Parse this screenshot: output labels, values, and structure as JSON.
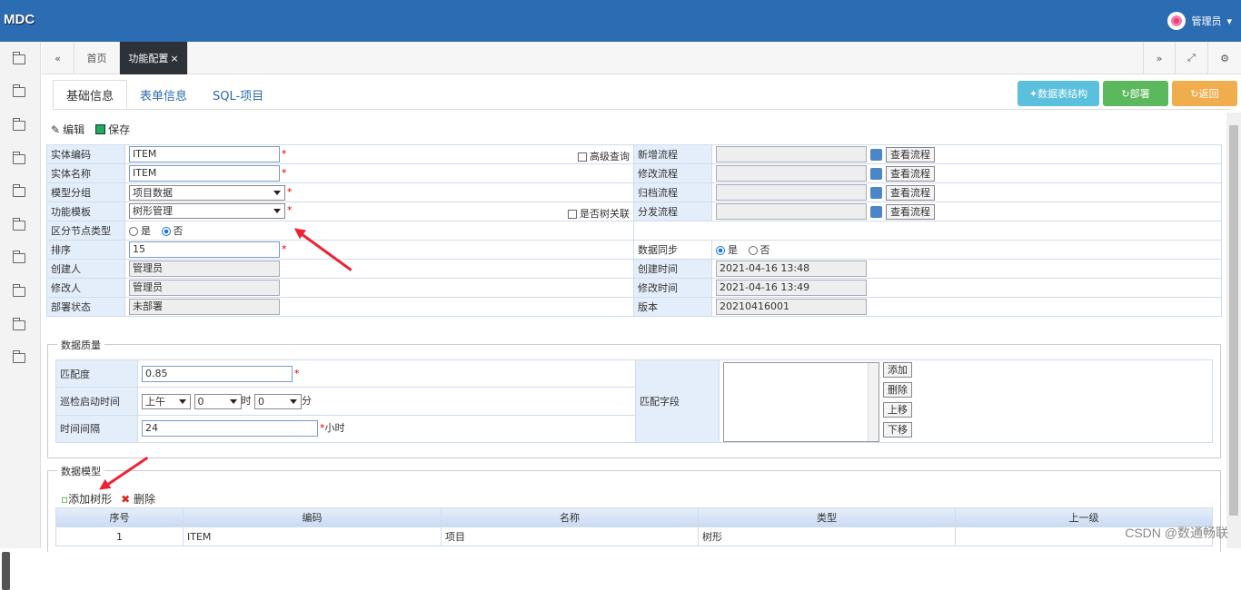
{
  "app": {
    "logo": "MDC",
    "user": "管理员"
  },
  "tabs": {
    "home": "首页",
    "current": "功能配置"
  },
  "subtabs": [
    "基础信息",
    "表单信息",
    "SQL-项目"
  ],
  "actions": {
    "table_struct": "数据表结构",
    "deploy": "部署",
    "back": "返回"
  },
  "toolbar": {
    "edit": "编辑",
    "save": "保存"
  },
  "form": {
    "entity_code_label": "实体编码",
    "entity_code": "ITEM",
    "entity_name_label": "实体名称",
    "entity_name": "ITEM",
    "model_group_label": "模型分组",
    "model_group": "项目数据",
    "func_template_label": "功能模板",
    "func_template": "树形管理",
    "node_type_label": "区分节点类型",
    "yes": "是",
    "no": "否",
    "order_label": "排序",
    "order": "15",
    "creator_label": "创建人",
    "creator": "管理员",
    "modifier_label": "修改人",
    "modifier": "管理员",
    "deploy_status_label": "部署状态",
    "deploy_status": "未部署",
    "advanced_query": "高级查询",
    "is_tree_assoc": "是否树关联",
    "new_flow_label": "新增流程",
    "edit_flow_label": "修改流程",
    "archive_flow_label": "归档流程",
    "dist_flow_label": "分发流程",
    "view_flow": "查看流程",
    "data_sync_label": "数据同步",
    "create_time_label": "创建时间",
    "create_time": "2021-04-16 13:48",
    "modify_time_label": "修改时间",
    "modify_time": "2021-04-16 13:49",
    "version_label": "版本",
    "version": "20210416001"
  },
  "quality": {
    "legend": "数据质量",
    "match_label": "匹配度",
    "match": "0.85",
    "patrol_label": "巡检启动时间",
    "ampm": "上午",
    "hour": "0",
    "hour_unit": "时",
    "minute": "0",
    "minute_unit": "分",
    "interval_label": "时间间隔",
    "interval": "24",
    "interval_unit": "小时",
    "fields_label": "匹配字段",
    "btn_add": "添加",
    "btn_delete": "删除",
    "btn_up": "上移",
    "btn_down": "下移"
  },
  "model": {
    "legend": "数据模型",
    "add_tree": "添加树形",
    "delete": "删除",
    "columns": [
      "序号",
      "编码",
      "名称",
      "类型",
      "上一级"
    ],
    "rows": [
      [
        "1",
        "ITEM",
        "项目",
        "树形",
        ""
      ]
    ]
  },
  "watermark": "CSDN @数通畅联"
}
